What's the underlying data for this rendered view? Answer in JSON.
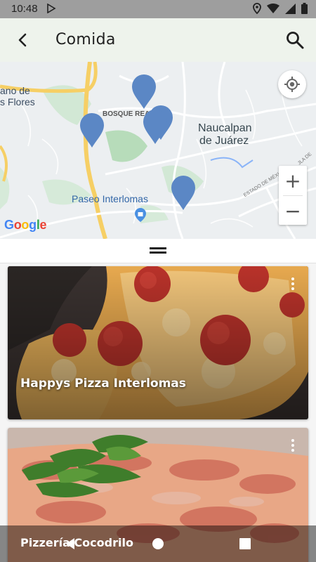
{
  "status_bar": {
    "time": "10:48"
  },
  "app_bar": {
    "title": "Comida"
  },
  "map": {
    "labels": {
      "left_1": "ano de",
      "left_2": "s Flores",
      "bosque_real": "BOSQUE REAL",
      "city_1": "Naucalpan",
      "city_2": "de Juárez",
      "paseo": "Paseo Interlomas",
      "road_1": "ESTADO DE MÉXICO",
      "road_2": "JLA DE"
    },
    "zoom_in": "+",
    "zoom_out": "−",
    "attribution": "Google",
    "marker_color": "#5b87c5"
  },
  "restaurants": [
    {
      "name": "Happys Pizza Interlomas"
    },
    {
      "name": "Pizzería Cocodrilo"
    }
  ]
}
